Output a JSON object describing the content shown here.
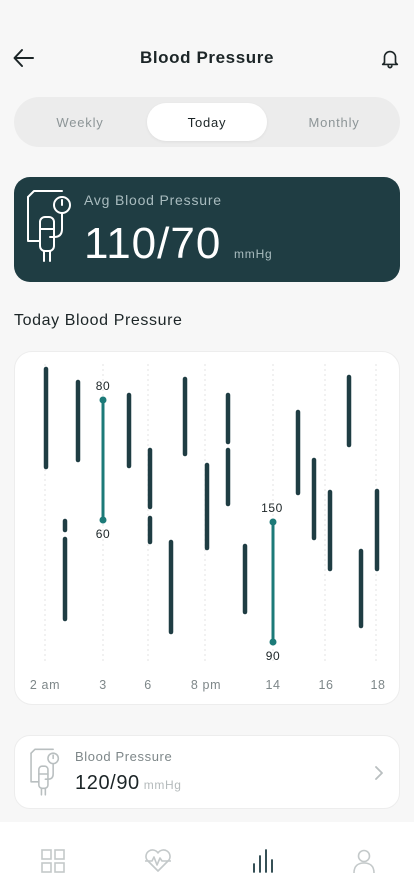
{
  "header": {
    "title": "Blood Pressure"
  },
  "segments": [
    "Weekly",
    "Today",
    "Monthly"
  ],
  "active_segment": "Today",
  "avg": {
    "label": "Avg Blood Pressure",
    "value": "110/70",
    "unit": "mmHg"
  },
  "section_title": "Today Blood Pressure",
  "chart_data": {
    "type": "range-bar",
    "x_tick_labels": [
      "2 am",
      "3",
      "6",
      "8 pm",
      "14",
      "16",
      "18"
    ],
    "highlighted": [
      {
        "high_label": "80",
        "low_label": "60"
      },
      {
        "high_label": "150",
        "low_label": "90"
      }
    ],
    "colors": {
      "bar": "#1f3d43",
      "highlight": "#1c7a78",
      "grid": "#e3e3e3"
    }
  },
  "bp_card": {
    "label": "Blood Pressure",
    "value": "120/90",
    "unit": "mmHg"
  },
  "tabs": [
    {
      "name": "grid-icon"
    },
    {
      "name": "heart-pulse-icon"
    },
    {
      "name": "bar-chart-icon"
    },
    {
      "name": "user-icon"
    }
  ]
}
